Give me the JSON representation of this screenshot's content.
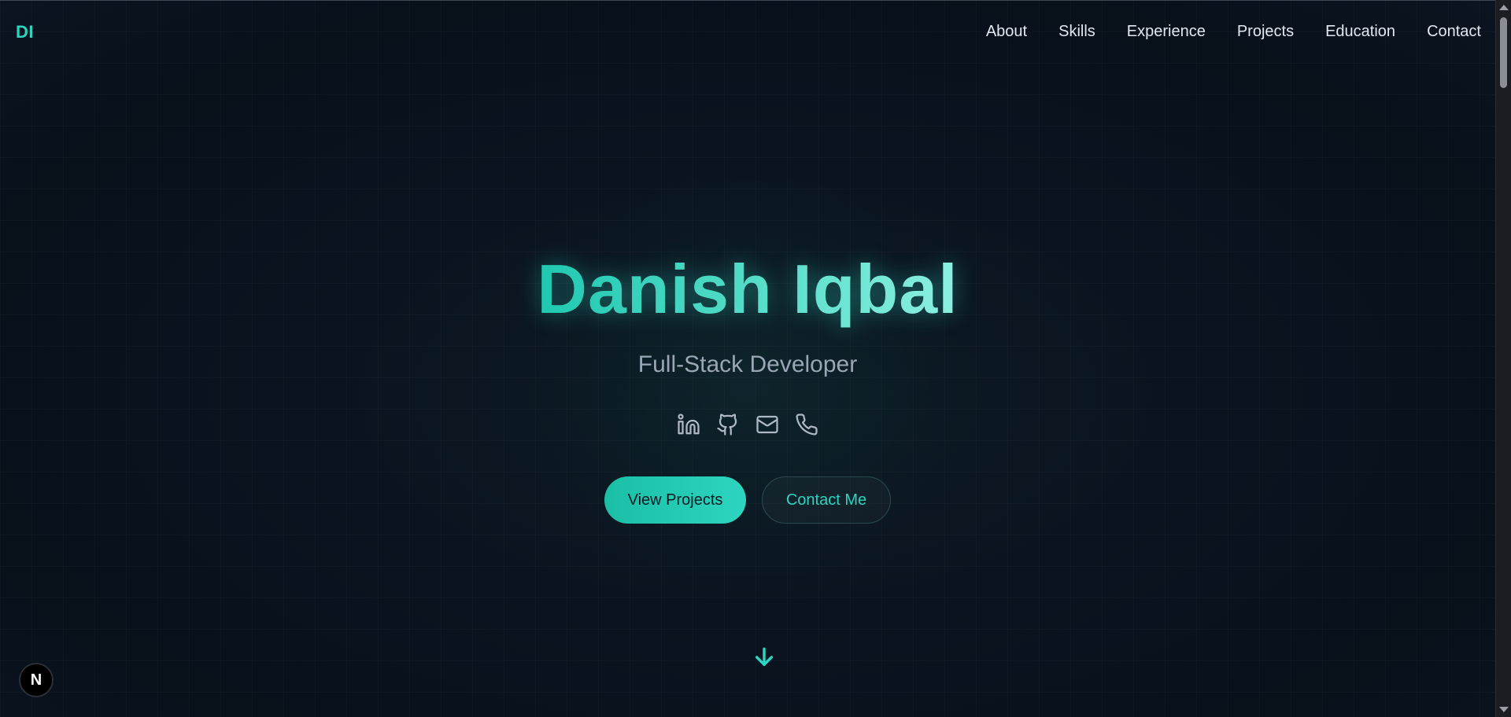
{
  "nav": {
    "logo": "DI",
    "links": [
      "About",
      "Skills",
      "Experience",
      "Projects",
      "Education",
      "Contact"
    ]
  },
  "hero": {
    "name": "Danish Iqbal",
    "subtitle": "Full-Stack Developer",
    "social_icons": [
      "linkedin-icon",
      "github-icon",
      "mail-icon",
      "phone-icon"
    ],
    "primary_button": "View Projects",
    "secondary_button": "Contact Me",
    "scroll_icon": "arrow-down-icon"
  },
  "badge": {
    "letter": "N"
  },
  "colors": {
    "accent": "#2dd4bf",
    "background": "#0a1420",
    "text": "#e2e8f0",
    "muted": "#9aa6b5"
  }
}
